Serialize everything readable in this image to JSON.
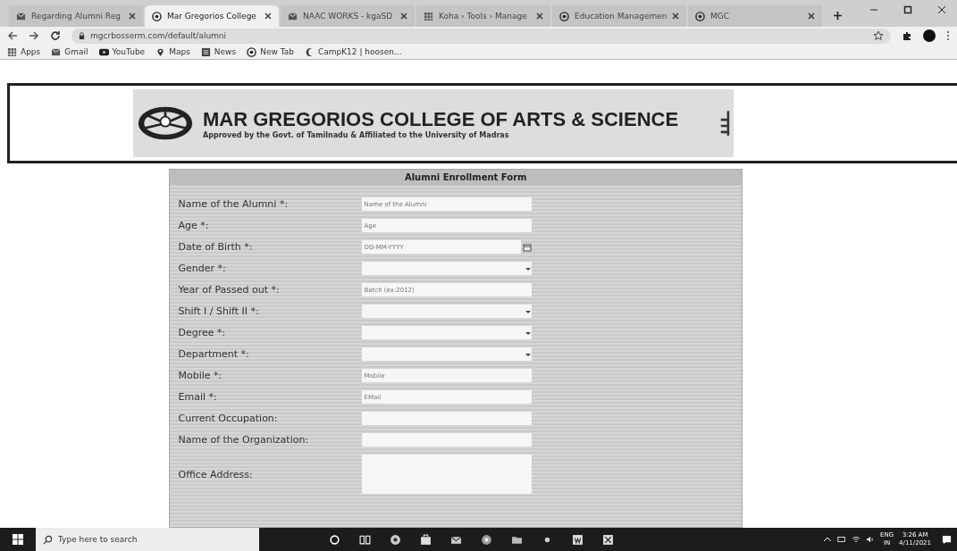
{
  "browser": {
    "tabs": [
      {
        "title": "Regarding Alumni Reg",
        "kind": "mail",
        "selected": false
      },
      {
        "title": "Mar Gregorios College",
        "kind": "globe",
        "selected": true
      },
      {
        "title": "NAAC WORKS - kgaSD",
        "kind": "mail",
        "selected": false
      },
      {
        "title": "Koha › Tools › Manage",
        "kind": "grid",
        "selected": false
      },
      {
        "title": "Education Managemen",
        "kind": "globe",
        "selected": false
      },
      {
        "title": "MGC",
        "kind": "globe",
        "selected": false
      }
    ],
    "address": "mgcrbosserm.com/default/alumni",
    "bookmarks": [
      {
        "label": "Apps",
        "kind": "grid"
      },
      {
        "label": "Gmail",
        "kind": "mail"
      },
      {
        "label": "YouTube",
        "kind": "play"
      },
      {
        "label": "Maps",
        "kind": "pin"
      },
      {
        "label": "News",
        "kind": "news"
      },
      {
        "label": "New Tab",
        "kind": "globe"
      },
      {
        "label": "CampK12 | hoosen...",
        "kind": "moon"
      }
    ]
  },
  "banner": {
    "title": "MAR GREGORIOS COLLEGE OF ARTS & SCIENCE",
    "subtitle": "Approved by the Govt. of Tamilnadu & Affiliated to the University of Madras"
  },
  "form": {
    "title": "Alumni Enrollment Form",
    "fields": [
      {
        "label": "Name of the Alumni  *:",
        "kind": "text",
        "placeholder": "Name of the Alumni"
      },
      {
        "label": "Age  *:",
        "kind": "text",
        "placeholder": "Age"
      },
      {
        "label": "Date of Birth  *:",
        "kind": "date",
        "placeholder": "DD-MM-YYYY"
      },
      {
        "label": "Gender  *:",
        "kind": "select"
      },
      {
        "label": "Year of Passed out  *:",
        "kind": "text",
        "placeholder": "Batch (ex:2012)"
      },
      {
        "label": "Shift I / Shift II  *:",
        "kind": "select"
      },
      {
        "label": "Degree  *:",
        "kind": "select"
      },
      {
        "label": "Department  *:",
        "kind": "select"
      },
      {
        "label": "Mobile  *:",
        "kind": "text",
        "placeholder": "Mobile"
      },
      {
        "label": "Email  *:",
        "kind": "text",
        "placeholder": "EMail"
      },
      {
        "label": "Current Occupation:",
        "kind": "text"
      },
      {
        "label": "Name of the Organization:",
        "kind": "text"
      },
      {
        "label": "Office Address:",
        "kind": "textarea"
      }
    ]
  },
  "taskbar": {
    "search_placeholder": "Type here to search",
    "language": "ENG",
    "region": "IN",
    "time": "3:26 AM",
    "date": "4/11/2021"
  }
}
